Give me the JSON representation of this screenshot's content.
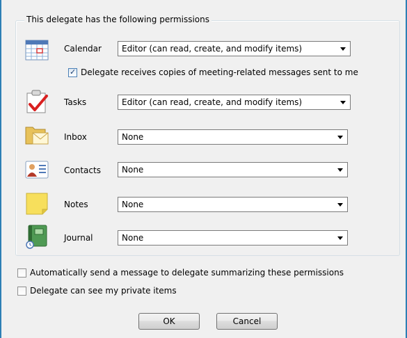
{
  "group_title": "This delegate has the following permissions",
  "permissions": [
    {
      "label": "Calendar",
      "value": "Editor (can read, create, and modify items)",
      "icon": "calendar-icon"
    },
    {
      "label": "Tasks",
      "value": "Editor (can read, create, and modify items)",
      "icon": "tasks-icon"
    },
    {
      "label": "Inbox",
      "value": "None",
      "icon": "inbox-icon"
    },
    {
      "label": "Contacts",
      "value": "None",
      "icon": "contacts-icon"
    },
    {
      "label": "Notes",
      "value": "None",
      "icon": "notes-icon"
    },
    {
      "label": "Journal",
      "value": "None",
      "icon": "journal-icon"
    }
  ],
  "meeting_copies": {
    "label": "Delegate receives copies of meeting-related messages sent to me",
    "checked": true
  },
  "auto_send": {
    "label": "Automatically send a message to delegate summarizing these permissions",
    "checked": false
  },
  "private_items": {
    "label": "Delegate can see my private items",
    "checked": false
  },
  "buttons": {
    "ok": "OK",
    "cancel": "Cancel"
  },
  "colors": {
    "border_accent": "#2d7fb5",
    "dialog_bg": "#f0f0f0"
  }
}
